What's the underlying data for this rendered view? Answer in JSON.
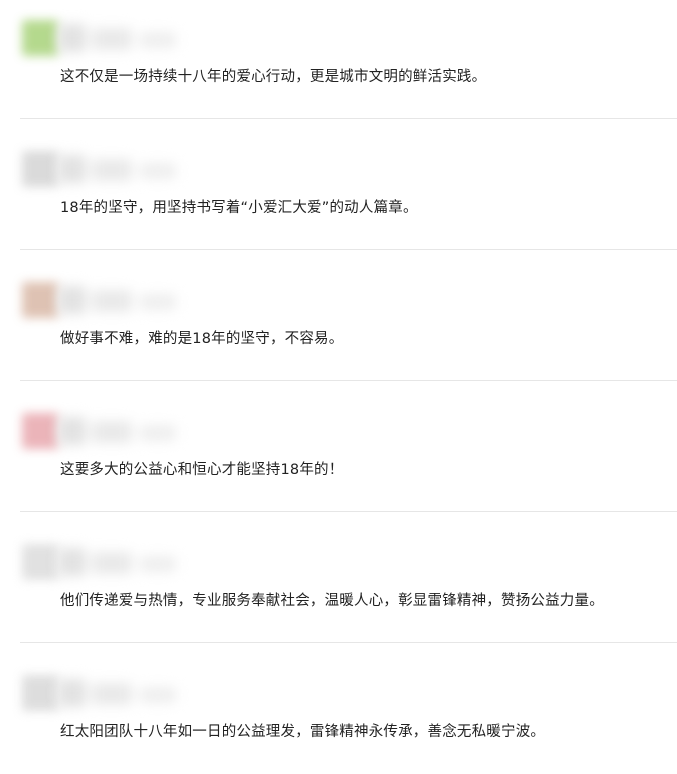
{
  "comments": [
    {
      "text": "这不仅是一场持续十八年的爱心行动，更是城市文明的鲜活实践。",
      "avatar_color": "#a8d37a"
    },
    {
      "text": "18年的坚守，用坚持书写着“小爱汇大爱”的动人篇章。",
      "avatar_color": "#d4d4d4"
    },
    {
      "text": "做好事不难，难的是18年的坚守，不容易。",
      "avatar_color": "#d9b8a6"
    },
    {
      "text": "这要多大的公益心和恒心才能坚持18年的！",
      "avatar_color": "#e8a7ad"
    },
    {
      "text": "他们传递爱与热情，专业服务奉献社会，温暖人心，彰显雷锋精神，赞扬公益力量。",
      "avatar_color": "#dcdcdc"
    },
    {
      "text": "红太阳团队十八年如一日的公益理发，雷锋精神永传承，善念无私暖宁波。",
      "avatar_color": "#d8d8d8"
    }
  ]
}
